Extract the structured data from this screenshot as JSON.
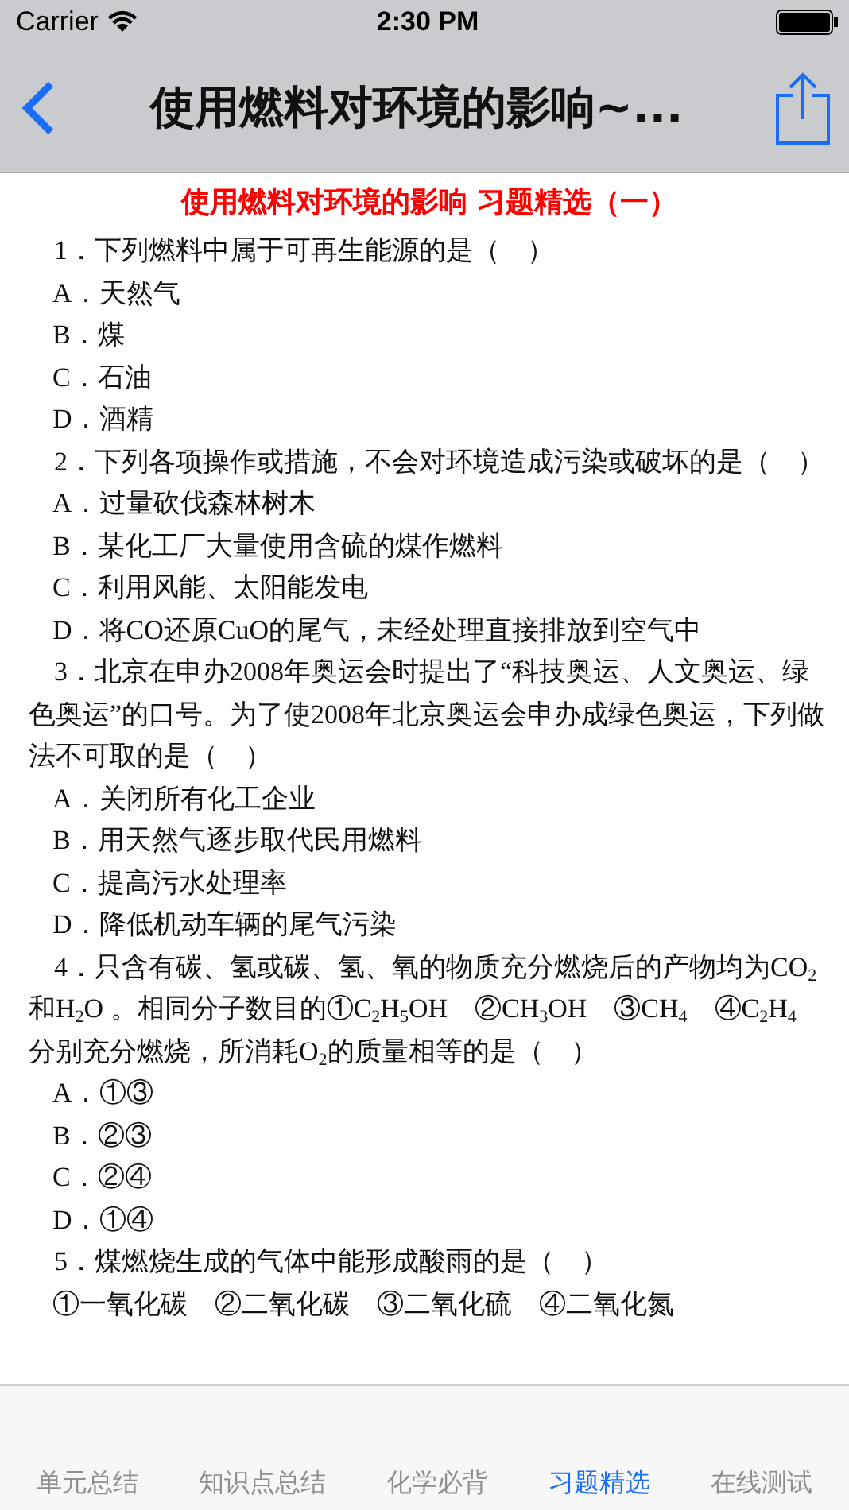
{
  "status_bar": {
    "carrier": "Carrier",
    "time": "2:30 PM"
  },
  "nav_bar": {
    "title": "使用燃料对环境的影响~..."
  },
  "content": {
    "heading": "使用燃料对环境的影响  习题精选（一）",
    "items": [
      {
        "kind": "question",
        "text": "1．下列燃料中属于可再生能源的是（　）"
      },
      {
        "kind": "option",
        "text": "A．天然气"
      },
      {
        "kind": "option",
        "text": "B．煤"
      },
      {
        "kind": "option",
        "text": "C．石油"
      },
      {
        "kind": "option",
        "text": "D．酒精"
      },
      {
        "kind": "question",
        "text": "2．下列各项操作或措施，不会对环境造成污染或破坏的是（　）"
      },
      {
        "kind": "option",
        "text": "A．过量砍伐森林树木"
      },
      {
        "kind": "option",
        "text": "B．某化工厂大量使用含硫的煤作燃料"
      },
      {
        "kind": "option",
        "text": "C．利用风能、太阳能发电"
      },
      {
        "kind": "option",
        "text": "D．将CO还原CuO的尾气，未经处理直接排放到空气中"
      },
      {
        "kind": "question",
        "text": "3．北京在申办2008年奥运会时提出了“科技奥运、人文奥运、绿色奥运”的口号。为了使2008年北京奥运会申办成绿色奥运，下列做法不可取的是（　）"
      },
      {
        "kind": "option",
        "text": "A．关闭所有化工企业"
      },
      {
        "kind": "option",
        "text": "B．用天然气逐步取代民用燃料"
      },
      {
        "kind": "option",
        "text": "C．提高污水处理率"
      },
      {
        "kind": "option",
        "text": "D．降低机动车辆的尾气污染"
      },
      {
        "kind": "question",
        "text": "4．只含有碳、氢或碳、氢、氧的物质充分燃烧后的产物均为CO$_{2}$和H$_{2}$O 。相同分子数目的①C$_{2}$H$_{5}$OH　②CH$_{3}$OH　③CH$_{4}$　④C$_{2}$H$_{4}$ 分别充分燃烧，所消耗O$_{2}$的质量相等的是（　）"
      },
      {
        "kind": "option",
        "text": "A．①③"
      },
      {
        "kind": "option",
        "text": "B．②③"
      },
      {
        "kind": "option",
        "text": "C．②④"
      },
      {
        "kind": "option",
        "text": "D．①④"
      },
      {
        "kind": "question",
        "text": "5．煤燃烧生成的气体中能形成酸雨的是（　）"
      },
      {
        "kind": "option",
        "text": "①一氧化碳　②二氧化碳　③二氧化硫　④二氧化氮"
      }
    ]
  },
  "tab_bar": {
    "tabs": [
      {
        "label": "单元总结",
        "selected": false
      },
      {
        "label": "知识点总结",
        "selected": false
      },
      {
        "label": "化学必背",
        "selected": false
      },
      {
        "label": "习题精选",
        "selected": true
      },
      {
        "label": "在线测试",
        "selected": false
      }
    ]
  }
}
